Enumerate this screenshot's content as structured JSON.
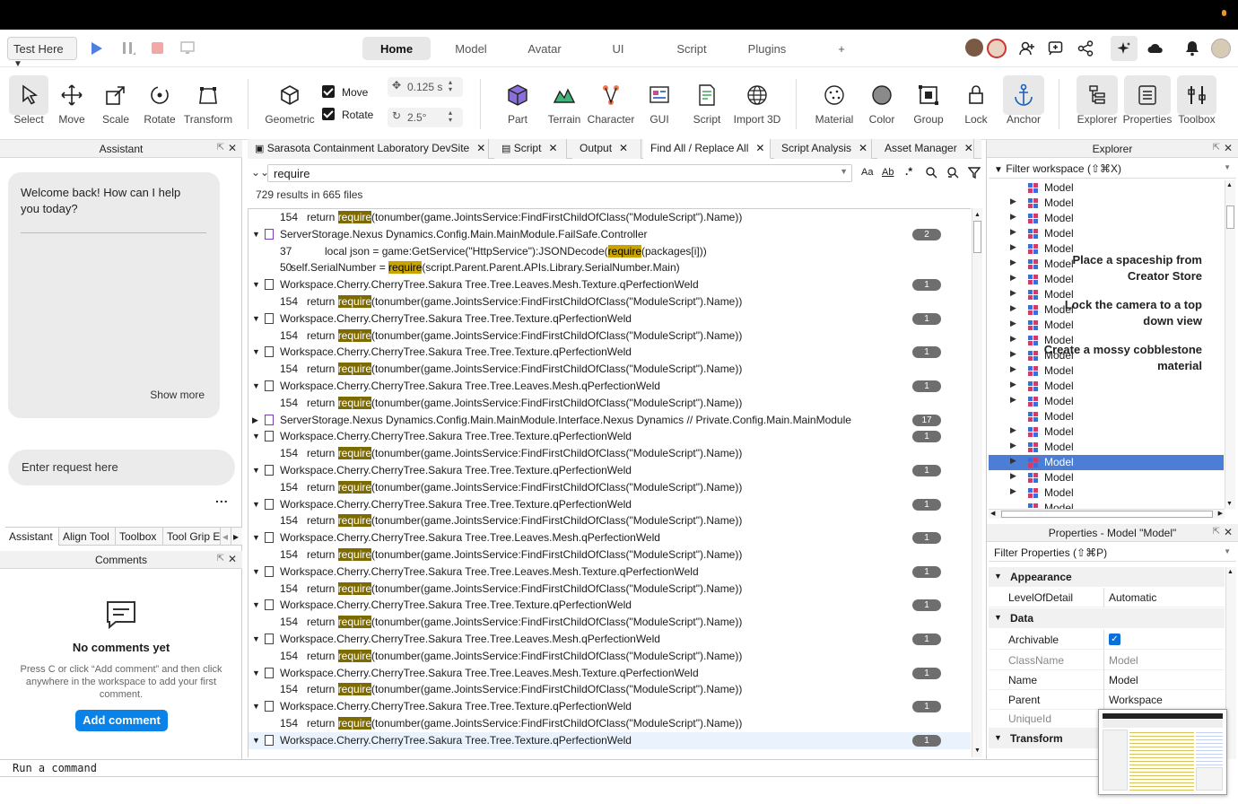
{
  "menubar": {
    "test_dropdown": "Test Here",
    "tabs": [
      "Home",
      "Model",
      "Avatar",
      "UI",
      "Script",
      "Plugins",
      "+"
    ],
    "active_tab": "Home"
  },
  "ribbon": {
    "tools": [
      "Select",
      "Move",
      "Scale",
      "Rotate",
      "Transform"
    ],
    "geometric": "Geometric",
    "move_label": "Move",
    "rotate_label": "Rotate",
    "move_increment": "0.125 s",
    "rotate_increment": "2.5°",
    "insert": [
      "Part",
      "Terrain",
      "Character",
      "GUI",
      "Script",
      "Import 3D"
    ],
    "edit": [
      "Material",
      "Color",
      "Group",
      "Lock",
      "Anchor"
    ],
    "windows": [
      "Explorer",
      "Properties",
      "Toolbox"
    ]
  },
  "assistant": {
    "title": "Assistant",
    "welcome": "Welcome back! How can I help you today?",
    "suggestions": [
      "Place a spaceship from Creator Store",
      "Lock the camera to a top down view",
      "Create a mossy cobblestone material"
    ],
    "show_more": "Show more",
    "request_placeholder": "Enter request here",
    "more": "...",
    "tabs": [
      "Assistant",
      "Align Tool",
      "Toolbox",
      "Tool Grip E"
    ]
  },
  "comments": {
    "title": "Comments",
    "empty_title": "No comments yet",
    "empty_text": "Press C or click “Add comment” and then click anywhere in the workspace to add your first comment.",
    "add_button": "Add comment"
  },
  "doc_tabs": [
    "Sarasota Containment Laboratory DevSite",
    "Script",
    "Output",
    "Find All / Replace All",
    "Script Analysis",
    "Asset Manager"
  ],
  "find": {
    "query": "require",
    "summary": "729 results in 665 files",
    "option_case": "Aa",
    "option_word": "Ab",
    "option_regex": ".*",
    "rows": [
      {
        "t": "line",
        "ln": "154",
        "pre": "return ",
        "hit": "require",
        "post": "(tonumber(game.JointsService:FindFirstChildOfClass(\"ModuleScript\").Name))"
      },
      {
        "t": "file",
        "path": "ServerStorage.Nexus Dynamics.Config.Main.MainModule.FailSafe.Controller",
        "count": "2",
        "m": true,
        "open": true
      },
      {
        "t": "line",
        "ln": "37",
        "pre": "      local json = game:GetService(\"HttpService\"):JSONDecode(",
        "hit": "require",
        "post": "(packages[i]))",
        "bright": true
      },
      {
        "t": "line2",
        "ln": "50",
        "pre": "self.SerialNumber = ",
        "hit": "require",
        "post": "(script.Parent.Parent.APIs.Library.SerialNumber.Main)",
        "bright": true
      },
      {
        "t": "file",
        "path": "Workspace.Cherry.CherryTree.Sakura Tree.Tree.Leaves.Mesh.Texture.qPerfectionWeld",
        "count": "1",
        "open": true
      },
      {
        "t": "line",
        "ln": "154",
        "pre": "return ",
        "hit": "require",
        "post": "(tonumber(game.JointsService:FindFirstChildOfClass(\"ModuleScript\").Name))"
      },
      {
        "t": "file",
        "path": "Workspace.Cherry.CherryTree.Sakura Tree.Tree.Texture.qPerfectionWeld",
        "count": "1",
        "open": true
      },
      {
        "t": "line",
        "ln": "154",
        "pre": "return ",
        "hit": "require",
        "post": "(tonumber(game.JointsService:FindFirstChildOfClass(\"ModuleScript\").Name))"
      },
      {
        "t": "file",
        "path": "Workspace.Cherry.CherryTree.Sakura Tree.Tree.Texture.qPerfectionWeld",
        "count": "1",
        "open": true
      },
      {
        "t": "line",
        "ln": "154",
        "pre": "return ",
        "hit": "require",
        "post": "(tonumber(game.JointsService:FindFirstChildOfClass(\"ModuleScript\").Name))"
      },
      {
        "t": "file",
        "path": "Workspace.Cherry.CherryTree.Sakura Tree.Tree.Leaves.Mesh.qPerfectionWeld",
        "count": "1",
        "open": true
      },
      {
        "t": "line",
        "ln": "154",
        "pre": "return ",
        "hit": "require",
        "post": "(tonumber(game.JointsService:FindFirstChildOfClass(\"ModuleScript\").Name))"
      },
      {
        "t": "file",
        "path": "ServerStorage.Nexus Dynamics.Config.Main.MainModule.Interface.Nexus Dynamics // Private.Config.Main.MainModule",
        "count": "17",
        "m": true,
        "open": false
      },
      {
        "t": "file",
        "path": "Workspace.Cherry.CherryTree.Sakura Tree.Tree.Texture.qPerfectionWeld",
        "count": "1",
        "open": true
      },
      {
        "t": "line",
        "ln": "154",
        "pre": "return ",
        "hit": "require",
        "post": "(tonumber(game.JointsService:FindFirstChildOfClass(\"ModuleScript\").Name))"
      },
      {
        "t": "file",
        "path": "Workspace.Cherry.CherryTree.Sakura Tree.Tree.Texture.qPerfectionWeld",
        "count": "1",
        "open": true
      },
      {
        "t": "line",
        "ln": "154",
        "pre": "return ",
        "hit": "require",
        "post": "(tonumber(game.JointsService:FindFirstChildOfClass(\"ModuleScript\").Name))"
      },
      {
        "t": "file",
        "path": "Workspace.Cherry.CherryTree.Sakura Tree.Tree.Texture.qPerfectionWeld",
        "count": "1",
        "open": true
      },
      {
        "t": "line",
        "ln": "154",
        "pre": "return ",
        "hit": "require",
        "post": "(tonumber(game.JointsService:FindFirstChildOfClass(\"ModuleScript\").Name))"
      },
      {
        "t": "file",
        "path": "Workspace.Cherry.CherryTree.Sakura Tree.Tree.Leaves.Mesh.qPerfectionWeld",
        "count": "1",
        "open": true
      },
      {
        "t": "line",
        "ln": "154",
        "pre": "return ",
        "hit": "require",
        "post": "(tonumber(game.JointsService:FindFirstChildOfClass(\"ModuleScript\").Name))"
      },
      {
        "t": "file",
        "path": "Workspace.Cherry.CherryTree.Sakura Tree.Tree.Leaves.Mesh.Texture.qPerfectionWeld",
        "count": "1",
        "open": true
      },
      {
        "t": "line",
        "ln": "154",
        "pre": "return ",
        "hit": "require",
        "post": "(tonumber(game.JointsService:FindFirstChildOfClass(\"ModuleScript\").Name))"
      },
      {
        "t": "file",
        "path": "Workspace.Cherry.CherryTree.Sakura Tree.Tree.Texture.qPerfectionWeld",
        "count": "1",
        "open": true
      },
      {
        "t": "line",
        "ln": "154",
        "pre": "return ",
        "hit": "require",
        "post": "(tonumber(game.JointsService:FindFirstChildOfClass(\"ModuleScript\").Name))"
      },
      {
        "t": "file",
        "path": "Workspace.Cherry.CherryTree.Sakura Tree.Tree.Leaves.Mesh.qPerfectionWeld",
        "count": "1",
        "open": true
      },
      {
        "t": "line",
        "ln": "154",
        "pre": "return ",
        "hit": "require",
        "post": "(tonumber(game.JointsService:FindFirstChildOfClass(\"ModuleScript\").Name))"
      },
      {
        "t": "file",
        "path": "Workspace.Cherry.CherryTree.Sakura Tree.Tree.Leaves.Mesh.Texture.qPerfectionWeld",
        "count": "1",
        "open": true
      },
      {
        "t": "line",
        "ln": "154",
        "pre": "return ",
        "hit": "require",
        "post": "(tonumber(game.JointsService:FindFirstChildOfClass(\"ModuleScript\").Name))"
      },
      {
        "t": "file",
        "path": "Workspace.Cherry.CherryTree.Sakura Tree.Tree.Texture.qPerfectionWeld",
        "count": "1",
        "open": true
      },
      {
        "t": "line",
        "ln": "154",
        "pre": "return ",
        "hit": "require",
        "post": "(tonumber(game.JointsService:FindFirstChildOfClass(\"ModuleScript\").Name))"
      },
      {
        "t": "file",
        "path": "Workspace.Cherry.CherryTree.Sakura Tree.Tree.Texture.qPerfectionWeld",
        "count": "1",
        "open": true,
        "selected": true
      }
    ]
  },
  "explorer": {
    "title": "Explorer",
    "filter": "Filter workspace (⇧⌘X)",
    "items": [
      "Model",
      "Model",
      "Model",
      "Model",
      "Model",
      "Model",
      "Model",
      "Model",
      "Model",
      "Model",
      "Model",
      "Model",
      "Model",
      "Model",
      "Model",
      "Model",
      "Model",
      "Model",
      "Model",
      "Model",
      "Model",
      "Model"
    ],
    "expandable": [
      false,
      true,
      true,
      true,
      true,
      true,
      true,
      true,
      true,
      true,
      true,
      true,
      true,
      true,
      true,
      false,
      true,
      true,
      true,
      true,
      true,
      false
    ],
    "selected_index": 18
  },
  "properties": {
    "title": "Properties - Model \"Model\"",
    "filter": "Filter Properties (⇧⌘P)",
    "sections": {
      "appearance": "Appearance",
      "data": "Data",
      "transform": "Transform"
    },
    "level_of_detail": {
      "k": "LevelOfDetail",
      "v": "Automatic"
    },
    "archivable": {
      "k": "Archivable"
    },
    "classname": {
      "k": "ClassName",
      "v": "Model"
    },
    "name": {
      "k": "Name",
      "v": "Model"
    },
    "parent": {
      "k": "Parent",
      "v": "Workspace"
    },
    "uniqueid": {
      "k": "UniqueId"
    }
  },
  "command_bar": {
    "placeholder": "Run a command"
  }
}
